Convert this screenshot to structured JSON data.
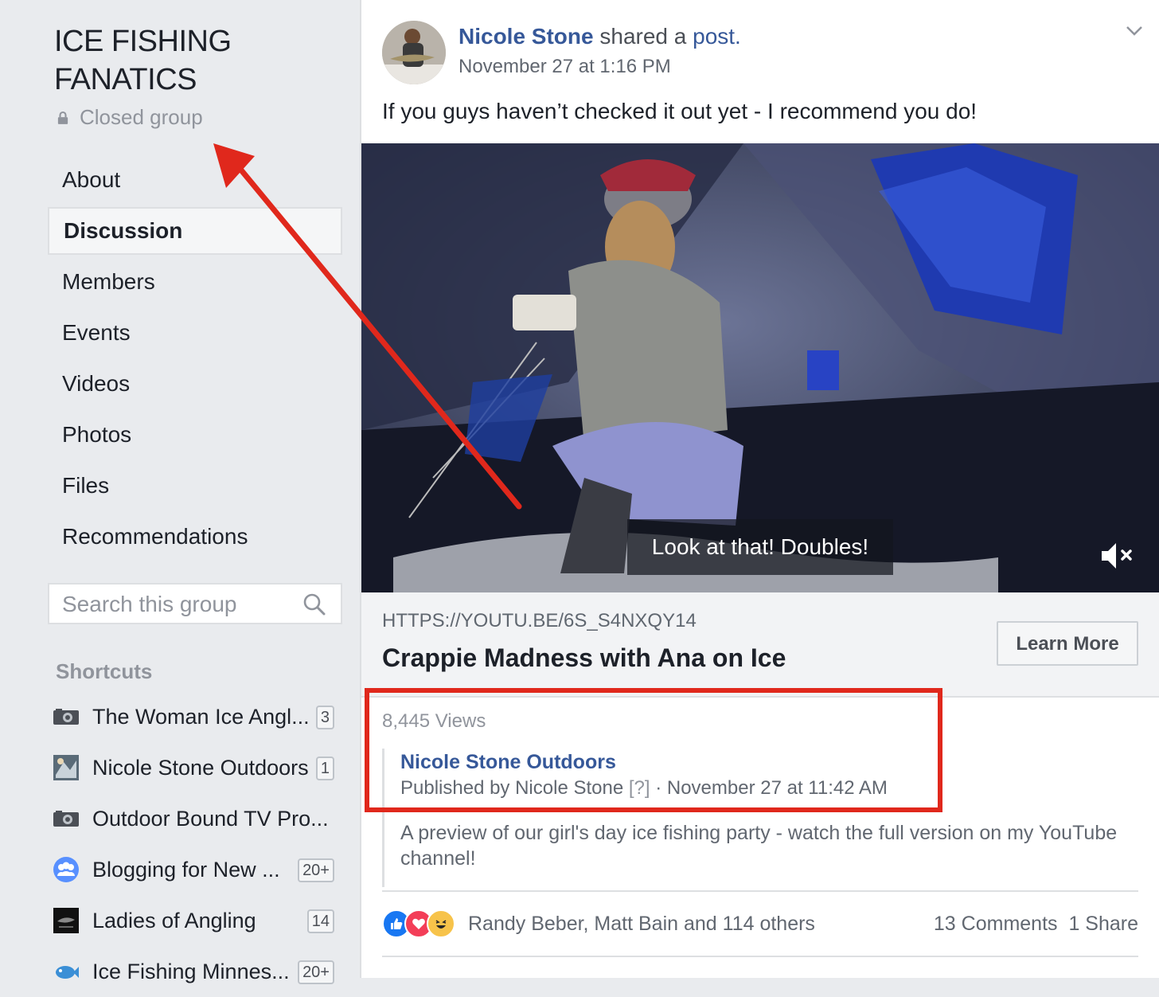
{
  "group": {
    "title_line1": "ICE FISHING",
    "title_line2": "FANATICS",
    "privacy": "Closed group"
  },
  "nav": [
    {
      "label": "About",
      "active": false
    },
    {
      "label": "Discussion",
      "active": true
    },
    {
      "label": "Members",
      "active": false
    },
    {
      "label": "Events",
      "active": false
    },
    {
      "label": "Videos",
      "active": false
    },
    {
      "label": "Photos",
      "active": false
    },
    {
      "label": "Files",
      "active": false
    },
    {
      "label": "Recommendations",
      "active": false
    }
  ],
  "search": {
    "placeholder": "Search this group"
  },
  "shortcuts": {
    "heading": "Shortcuts",
    "items": [
      {
        "name": "The Woman Ice Angl...",
        "badge": "3",
        "icon": "camera"
      },
      {
        "name": "Nicole Stone Outdoors",
        "badge": "1",
        "icon": "photo"
      },
      {
        "name": "Outdoor Bound TV Pro...",
        "badge": "",
        "icon": "camera"
      },
      {
        "name": "Blogging for New ...",
        "badge": "20+",
        "icon": "group"
      },
      {
        "name": "Ladies of Angling",
        "badge": "14",
        "icon": "dark"
      },
      {
        "name": "Ice Fishing Minnes...",
        "badge": "20+",
        "icon": "fish"
      }
    ]
  },
  "post": {
    "author": "Nicole Stone",
    "action": " shared a ",
    "post_link": "post.",
    "timestamp": "November 27 at 1:16 PM",
    "text": "If you guys haven’t checked it out yet - I recommend you do!",
    "video_caption": "Look at that! Doubles!",
    "link_url": "HTTPS://YOUTU.BE/6S_S4NXQY14",
    "link_title": "Crappie Madness with Ana on Ice",
    "learn_more": "Learn More",
    "views": "8,445 Views",
    "page_name": "Nicole Stone Outdoors",
    "published_prefix": "Published by Nicole Stone ",
    "published_qmark": "[?]",
    "published_suffix": " · November 27 at 11:42 AM",
    "description": "A preview of our girl's day ice fishing party - watch the full version on my YouTube channel!",
    "reaction_names": "Randy Beber, Matt Bain and 114 others",
    "comments": "13 Comments",
    "shares": "1 Share"
  },
  "colors": {
    "link": "#365899",
    "annotation_red": "#e0281c",
    "like_blue": "#1877f2",
    "love_red": "#f33e58",
    "haha_yellow": "#f7c34a"
  }
}
